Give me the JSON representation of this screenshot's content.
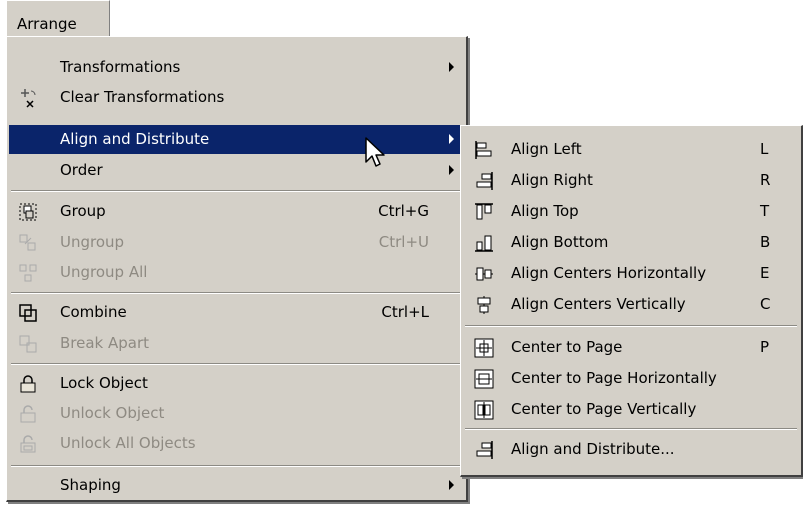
{
  "menubar": {
    "arrange_label": "Arrange"
  },
  "main_menu": {
    "transformations": "Transformations",
    "clear_transformations": "Clear Transformations",
    "align_and_distribute": "Align and Distribute",
    "order": "Order",
    "group": "Group",
    "group_shortcut": "Ctrl+G",
    "ungroup": "Ungroup",
    "ungroup_shortcut": "Ctrl+U",
    "ungroup_all": "Ungroup All",
    "combine": "Combine",
    "combine_shortcut": "Ctrl+L",
    "break_apart": "Break Apart",
    "lock_object": "Lock Object",
    "unlock_object": "Unlock Object",
    "unlock_all_objects": "Unlock All Objects",
    "shaping": "Shaping"
  },
  "sub_menu": {
    "align_left": "Align Left",
    "align_left_key": "L",
    "align_right": "Align Right",
    "align_right_key": "R",
    "align_top": "Align Top",
    "align_top_key": "T",
    "align_bottom": "Align Bottom",
    "align_bottom_key": "B",
    "align_centers_h": "Align Centers Horizontally",
    "align_centers_h_key": "E",
    "align_centers_v": "Align Centers Vertically",
    "align_centers_v_key": "C",
    "center_to_page": "Center to Page",
    "center_to_page_key": "P",
    "center_to_page_h": "Center to Page Horizontally",
    "center_to_page_v": "Center to Page Vertically",
    "align_and_distribute_dialog": "Align and Distribute..."
  },
  "colors": {
    "menu_bg": "#d4d0c8",
    "highlight": "#0a246a",
    "disabled": "#8e8a82"
  }
}
